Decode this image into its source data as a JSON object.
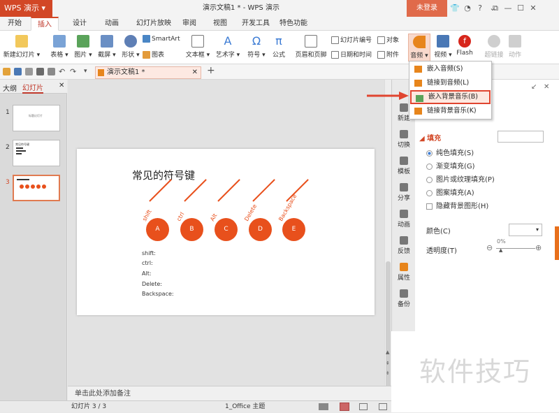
{
  "app": {
    "name": "WPS 演示",
    "window_title": "演示文稿1 * - WPS 演示",
    "login_label": "未登录",
    "title_icons": [
      "shirt-icon",
      "skin-icon",
      "help-icon",
      "menu-icon"
    ],
    "window_controls": [
      "restore-icon",
      "minimize-icon",
      "maximize-icon",
      "close-icon"
    ]
  },
  "tabs": [
    "开始",
    "插入",
    "设计",
    "动画",
    "幻灯片放映",
    "审阅",
    "视图",
    "开发工具",
    "特色功能"
  ],
  "active_tab": "插入",
  "ribbon": {
    "new_slide": "新建幻灯片",
    "table": "表格",
    "picture": "图片",
    "screenshot": "截屏",
    "shape": "形状",
    "smartart": "SmartArt",
    "chart": "图表",
    "textbox": "文本框",
    "wordart": "艺术字",
    "symbol": "符号",
    "formula": "公式",
    "header_footer": "页眉和页脚",
    "slide_number": "幻灯片编号",
    "datetime": "日期和时间",
    "object": "对象",
    "attachment": "附件",
    "audio": "音频",
    "video": "视频",
    "flash": "Flash",
    "hyperlink": "超链接",
    "action": "动作"
  },
  "document_tab": "演示文稿1 *",
  "left_pane": {
    "tab_outline": "大纲",
    "tab_slides": "幻灯片",
    "slide_numbers": [
      "1",
      "2",
      "3"
    ],
    "thumb1_title": "标题幻灯片",
    "thumb2_title": "常见符号键"
  },
  "slide": {
    "title": "常见的符号键",
    "circles": [
      "A",
      "B",
      "C",
      "D",
      "E"
    ],
    "circle_labels": [
      "shift",
      "ctrl",
      "Alt",
      "Delete",
      "Backspace"
    ],
    "lines": [
      "shift:",
      "ctrl:",
      "Alt:",
      "Delete:",
      "Backspace:"
    ]
  },
  "notes_placeholder": "单击此处添加备注",
  "status": {
    "slide_info": "幻灯片 3 / 3",
    "theme": "1_Office 主题"
  },
  "audio_menu": {
    "items": [
      "嵌入音频(S)",
      "链接到音频(L)",
      "嵌入背景音乐(B)",
      "链接背景音乐(K)"
    ],
    "highlighted_index": 2
  },
  "sidebar": [
    "新建",
    "切换",
    "模板",
    "分享",
    "动画",
    "反馈",
    "属性",
    "备份"
  ],
  "properties": {
    "fill_heading": "填充",
    "options": [
      "纯色填充(S)",
      "渐变填充(G)",
      "图片或纹理填充(P)",
      "图案填充(A)"
    ],
    "selected_option_index": 0,
    "hide_bg": "隐藏背景图形(H)",
    "color_label": "颜色(C)",
    "transparency_label": "透明度(T)",
    "transparency_value": "0%"
  },
  "watermark": "软件技巧",
  "colors": {
    "accent": "#d24726",
    "slide_orange": "#e8501c",
    "highlight_border": "#e04530"
  }
}
